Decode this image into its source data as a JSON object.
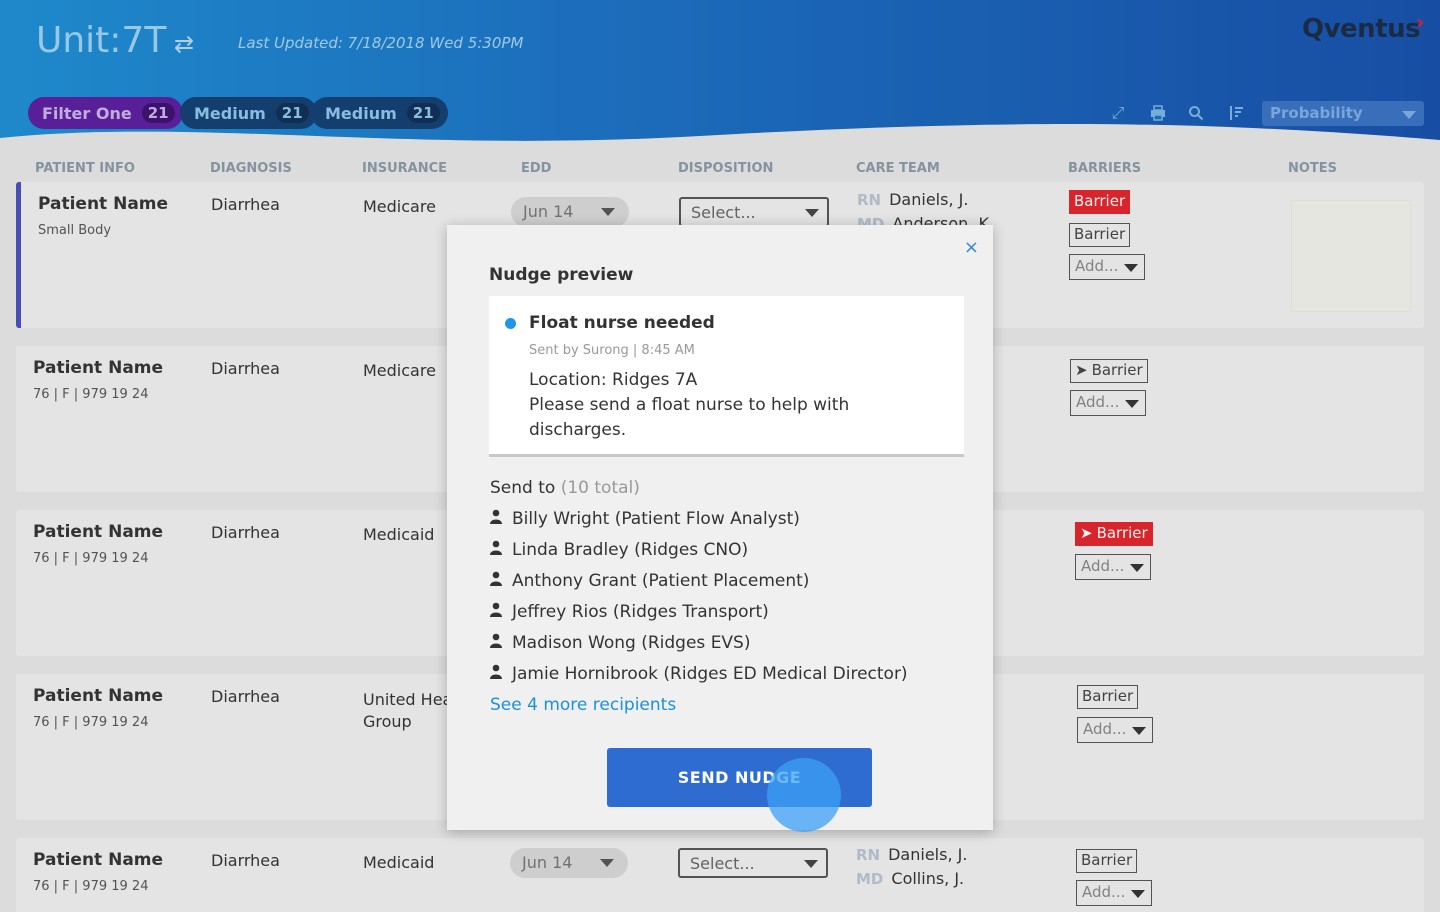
{
  "header": {
    "unit_title": "Unit:7T",
    "last_updated": "Last Updated: 7/18/2018 Wed  5:30PM",
    "logo": "Qventus",
    "filters": [
      {
        "label": "Filter One",
        "count": "21"
      },
      {
        "label": "Medium",
        "count": "21"
      },
      {
        "label": "Medium",
        "count": "21"
      }
    ],
    "sort_select": "Probability",
    "icons": [
      "expand-icon",
      "print-icon",
      "search-icon",
      "sort-icon"
    ]
  },
  "columns": [
    "PATIENT INFO",
    "DIAGNOSIS",
    "INSURANCE",
    "EDD",
    "DISPOSITION",
    "CARE TEAM",
    "BARRIERS",
    "NOTES"
  ],
  "rows": [
    {
      "name": "Patient Name",
      "sub": "Small Body",
      "diagnosis": "Diarrhea",
      "insurance": "Medicare",
      "edd": "Jun 14",
      "disposition": "Select...",
      "care": [
        {
          "role": "RN",
          "name": "Daniels, J."
        },
        {
          "role": "MD",
          "name": "Anderson, K."
        }
      ],
      "barriers": [
        "Barrier",
        "Barrier"
      ],
      "add": "Add..."
    },
    {
      "name": "Patient Name",
      "sub": "76  |  F  | 979 19 24",
      "diagnosis": "Diarrhea",
      "insurance": "Medicare",
      "barriers": [
        "Barrier"
      ],
      "add": "Add..."
    },
    {
      "name": "Patient Name",
      "sub": "76  |  F  | 979 19 24",
      "diagnosis": "Diarrhea",
      "insurance": "Medicaid",
      "barriers": [
        "Barrier"
      ],
      "add": "Add..."
    },
    {
      "name": "Patient Name",
      "sub": "76  |  F  | 979 19 24",
      "diagnosis": "Diarrhea",
      "insurance": "United Health Group",
      "barriers": [
        "Barrier"
      ],
      "add": "Add..."
    },
    {
      "name": "Patient Name",
      "sub": "76  |  F  | 979 19 24",
      "diagnosis": "Diarrhea",
      "insurance": "Medicaid",
      "edd": "Jun 14",
      "disposition": "Select...",
      "care": [
        {
          "role": "RN",
          "name": "Daniels, J."
        },
        {
          "role": "MD",
          "name": "Collins, J."
        }
      ],
      "barriers": [
        "Barrier"
      ],
      "add": "Add..."
    }
  ],
  "modal": {
    "title": "Nudge preview",
    "close": "×",
    "message": {
      "title": "Float nurse needed",
      "sent": "Sent by Surong | 8:45 AM",
      "body_line1": "Location: Ridges 7A",
      "body_line2": "Please send a float nurse to help with discharges."
    },
    "send_to_label": "Send to",
    "send_to_total": "(10 total)",
    "recipients": [
      "Billy Wright (Patient Flow Analyst)",
      "Linda Bradley (Ridges CNO)",
      "Anthony Grant (Patient Placement)",
      "Jeffrey Rios (Ridges Transport)",
      "Madison Wong (Ridges EVS)",
      "Jamie Hornibrook (Ridges ED Medical Director)"
    ],
    "more_link": "See 4 more recipients",
    "send_button": "SEND NUDGE"
  },
  "colors": {
    "accent": "#2e6cd1",
    "link": "#1b8fe0",
    "barrier_red": "#e3242b",
    "header": "#1a6fc4"
  }
}
